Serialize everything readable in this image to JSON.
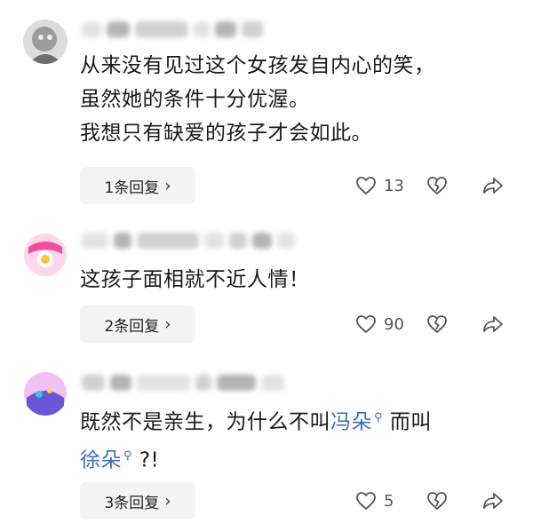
{
  "comments": [
    {
      "avatar_colors": [
        "#b9b9b9",
        "#7f7f7f"
      ],
      "text_lines": [
        "从来没有见过这个女孩发自内心的笑，",
        "虽然她的条件十分优渥。",
        "我想只有缺爱的孩子才会如此。"
      ],
      "reply_label": "1条回复",
      "like_count": "13"
    },
    {
      "avatar_colors": [
        "#ffd6ea",
        "#f04e9e"
      ],
      "text_lines": [
        "这孩子面相就不近人情！"
      ],
      "reply_label": "2条回复",
      "like_count": "90"
    },
    {
      "avatar_colors": [
        "#f1c2f4",
        "#6a57d8"
      ],
      "text_before": "既然不是亲生，为什么不叫",
      "mention1": "冯朵",
      "text_middle": " 而叫",
      "mention2": "徐朵",
      "text_after": " ?!",
      "reply_label": "3条回复",
      "like_count": "5"
    }
  ],
  "icons": {
    "reply_chevron": "›",
    "like": "heart-outline-icon",
    "dislike": "broken-heart-icon",
    "share": "share-arrow-icon",
    "mention_search": "search-icon"
  },
  "colors": {
    "mention": "#3d6fb3",
    "reply_bg": "#f4f4f4"
  }
}
